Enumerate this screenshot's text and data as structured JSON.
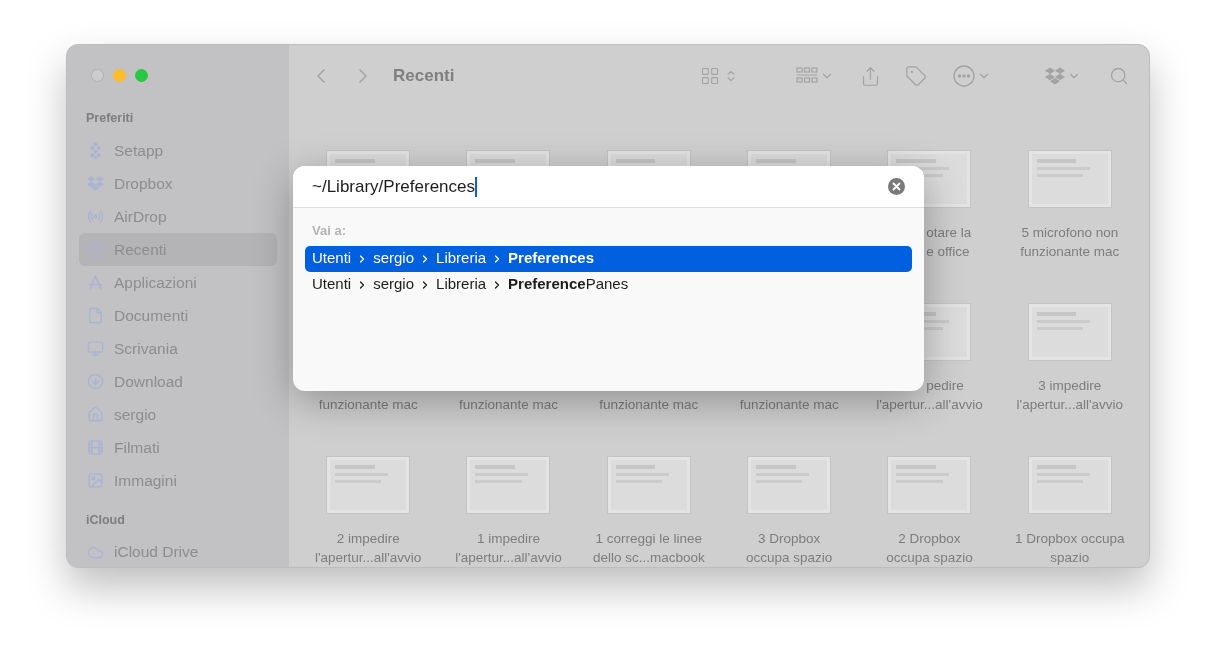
{
  "window": {
    "title": "Recenti"
  },
  "sidebar": {
    "sections": [
      {
        "header": "Preferiti",
        "items": [
          {
            "label": "Setapp",
            "selected": false
          },
          {
            "label": "Dropbox",
            "selected": false
          },
          {
            "label": "AirDrop",
            "selected": false
          },
          {
            "label": "Recenti",
            "selected": true
          },
          {
            "label": "Applicazioni",
            "selected": false
          },
          {
            "label": "Documenti",
            "selected": false
          },
          {
            "label": "Scrivania",
            "selected": false
          },
          {
            "label": "Download",
            "selected": false
          },
          {
            "label": "sergio",
            "selected": false
          },
          {
            "label": "Filmati",
            "selected": false
          },
          {
            "label": "Immagini",
            "selected": false
          }
        ]
      },
      {
        "header": "iCloud",
        "items": [
          {
            "label": "iCloud Drive",
            "selected": false
          }
        ]
      }
    ]
  },
  "files": [
    {
      "kind": "hidden"
    },
    {
      "kind": "hidden"
    },
    {
      "kind": "hidden"
    },
    {
      "kind": "hidden"
    },
    {
      "kind": "left-cut",
      "lines": [
        "otare la",
        "e office"
      ]
    },
    {
      "kind": "full",
      "lines": [
        "5 microfono non",
        "funzionante mac"
      ]
    },
    {
      "kind": "top-cut",
      "lines": [
        "funzionante mac"
      ]
    },
    {
      "kind": "top-cut",
      "lines": [
        "funzionante mac"
      ]
    },
    {
      "kind": "top-cut",
      "lines": [
        "funzionante mac"
      ]
    },
    {
      "kind": "top-cut",
      "lines": [
        "funzionante mac"
      ]
    },
    {
      "kind": "first-line-cut",
      "lines": [
        "pedire",
        "l'apertur...all'avvio"
      ]
    },
    {
      "kind": "full",
      "lines": [
        "3 impedire",
        "l'apertur...all'avvio"
      ]
    },
    {
      "kind": "full",
      "lines": [
        "2 impedire",
        "l'apertur...all'avvio"
      ]
    },
    {
      "kind": "full",
      "lines": [
        "1 impedire",
        "l'apertur...all'avvio"
      ]
    },
    {
      "kind": "full",
      "lines": [
        "1 correggi le linee",
        "dello sc...macbook"
      ]
    },
    {
      "kind": "full",
      "lines": [
        "3 Dropbox",
        "occupa spazio"
      ]
    },
    {
      "kind": "full",
      "lines": [
        "2 Dropbox",
        "occupa spazio"
      ]
    },
    {
      "kind": "full",
      "lines": [
        "1 Dropbox occupa",
        "spazio"
      ]
    }
  ],
  "goto_dialog": {
    "value": "~/Library/Preferences",
    "section_label": "Vai a:",
    "results": [
      {
        "selected": true,
        "segments": [
          "Utenti",
          "sergio",
          "Libreria",
          "**Preferences**"
        ]
      },
      {
        "selected": false,
        "segments": [
          "Utenti",
          "sergio",
          "Libreria",
          "**Preference**Panes"
        ]
      }
    ]
  }
}
